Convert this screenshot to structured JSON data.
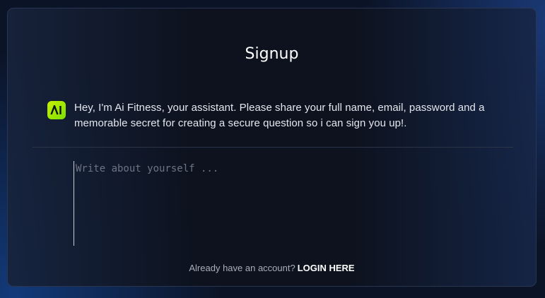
{
  "signup": {
    "title": "Signup",
    "assistant": {
      "avatar_text": "AI",
      "avatar_icon": "ai-fitness-logo",
      "message": "Hey, I'm Ai Fitness, your assistant. Please share your full name, email, password and a memorable secret for creating a secure question so i can sign you up!."
    },
    "input": {
      "value": "",
      "placeholder": "Write about yourself ..."
    },
    "footer": {
      "prompt": "Already have an account?",
      "login_label": "LOGIN HERE"
    }
  },
  "colors": {
    "accent": "#b6f000",
    "background": "#0b1326",
    "card_border": "#2a3650"
  }
}
